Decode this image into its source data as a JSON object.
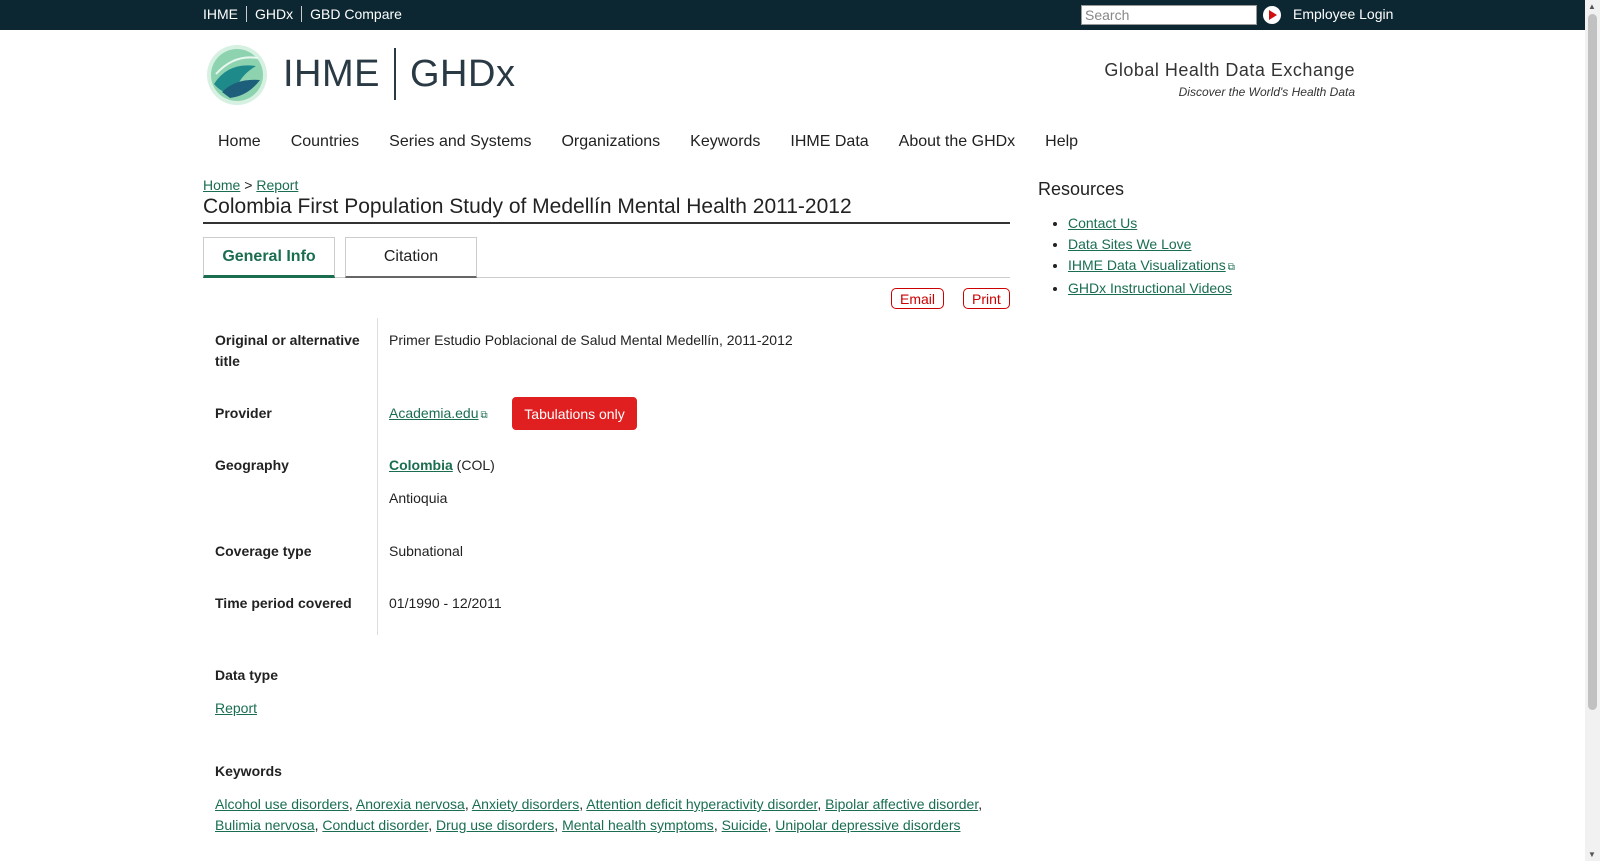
{
  "topbar": {
    "links": [
      "IHME",
      "GHDx",
      "GBD Compare"
    ],
    "search_placeholder": "Search",
    "login": "Employee Login"
  },
  "header": {
    "brand_left": "IHME",
    "brand_right": "GHDx",
    "tagline_title": "Global Health Data Exchange",
    "tagline_sub": "Discover the World's Health Data"
  },
  "nav": [
    "Home",
    "Countries",
    "Series and Systems",
    "Organizations",
    "Keywords",
    "IHME Data",
    "About the GHDx",
    "Help"
  ],
  "breadcrumb": {
    "home": "Home",
    "sep": ">",
    "current": "Report"
  },
  "page_title": "Colombia First Population Study of Medellín Mental Health 2011-2012",
  "tabs": {
    "general": "General Info",
    "citation": "Citation"
  },
  "actions": {
    "email": "Email",
    "print": "Print"
  },
  "fields": {
    "alt_title_label_1": "Original or alternative",
    "alt_title_label_2": "title",
    "alt_title_value": "Primer Estudio Poblacional de Salud Mental Medellín, 2011-2012",
    "provider_label": "Provider",
    "provider_value": "Academia.edu",
    "provider_badge": "Tabulations only",
    "geography_label": "Geography",
    "geography_country": "Colombia",
    "geography_code": "(COL)",
    "geography_region": "Antioquia",
    "coverage_label": "Coverage type",
    "coverage_value": "Subnational",
    "time_label": "Time period covered",
    "time_value": "01/1990 - 12/2011",
    "datatype_label": "Data type",
    "datatype_value": "Report",
    "keywords_label": "Keywords",
    "keywords": [
      "Alcohol use disorders",
      "Anorexia nervosa",
      "Anxiety disorders",
      "Attention deficit hyperactivity disorder",
      "Bipolar affective disorder",
      "Bulimia nervosa",
      "Conduct disorder",
      "Drug use disorders",
      "Mental health symptoms",
      "Suicide",
      "Unipolar depressive disorders"
    ]
  },
  "sidebar": {
    "title": "Resources",
    "items": [
      "Contact Us",
      "Data Sites We Love",
      "IHME Data Visualizations",
      "GHDx Instructional Videos"
    ]
  },
  "colors": {
    "topbar": "#0d2732",
    "link": "#1a6e4f",
    "badge": "#e02020"
  }
}
